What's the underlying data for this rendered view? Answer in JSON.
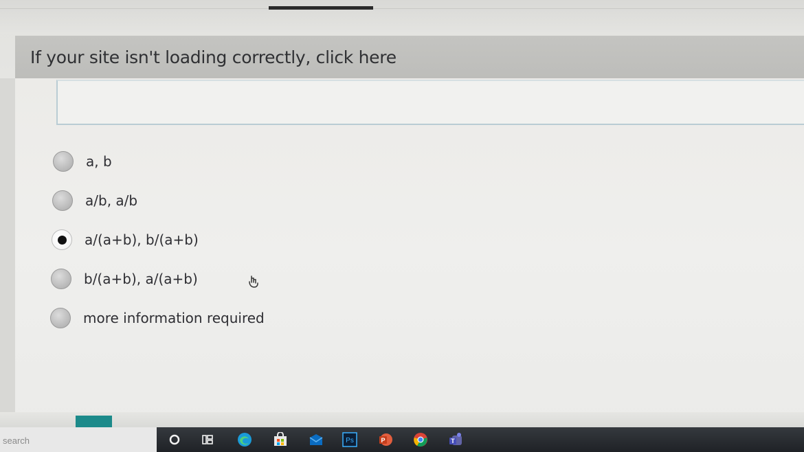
{
  "banner": {
    "link_text": "If your site isn't loading correctly, click here"
  },
  "question": {
    "options": [
      {
        "label": "a, b",
        "selected": false
      },
      {
        "label": "a/b, a/b",
        "selected": false
      },
      {
        "label": "a/(a+b), b/(a+b)",
        "selected": true
      },
      {
        "label": "b/(a+b), a/(a+b)",
        "selected": false
      },
      {
        "label": "more information required",
        "selected": false
      }
    ]
  },
  "taskbar": {
    "search_placeholder": "search",
    "icons": [
      "cortana-icon",
      "task-view-icon",
      "edge-icon",
      "store-icon",
      "mail-icon",
      "photoshop-icon",
      "powerpoint-icon",
      "chrome-icon",
      "teams-icon"
    ],
    "photoshop_label": "Ps"
  },
  "colors": {
    "banner_bg": "#c0c0bd",
    "progress_chip": "#1c8a8a",
    "taskbar_bg": "#25282c"
  }
}
